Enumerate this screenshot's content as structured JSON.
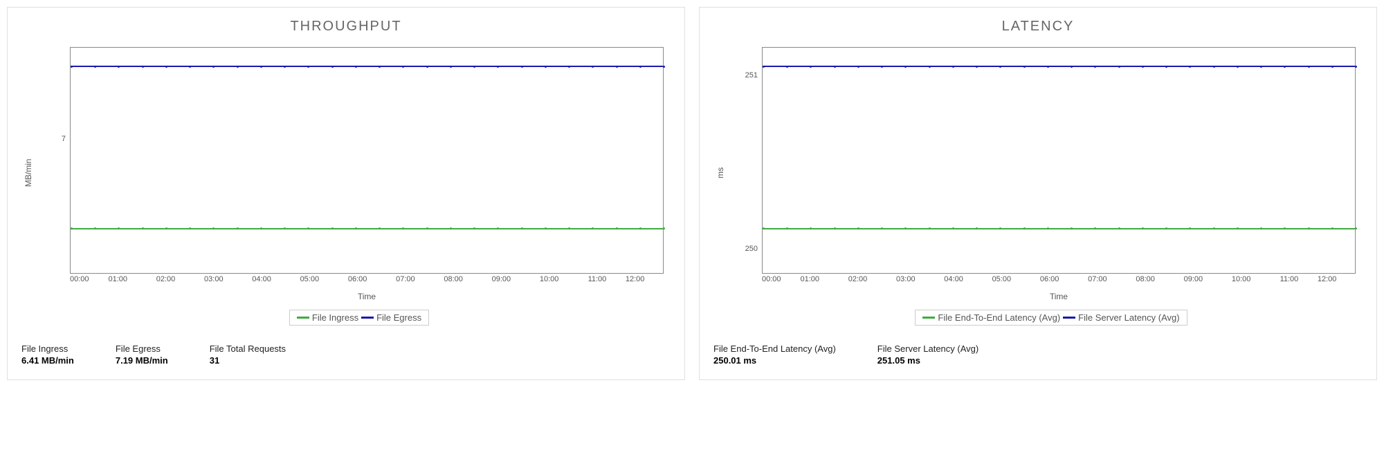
{
  "panels": {
    "throughput": {
      "title": "THROUGHPUT",
      "ylabel": "MB/min",
      "xlabel": "Time",
      "legend": {
        "a": "File Ingress",
        "b": "File Egress"
      },
      "ytick": "7",
      "stats": [
        {
          "label": "File Ingress",
          "value": "6.41 MB/min"
        },
        {
          "label": "File Egress",
          "value": "7.19 MB/min"
        },
        {
          "label": "File Total Requests",
          "value": "31"
        }
      ]
    },
    "latency": {
      "title": "LATENCY",
      "ylabel": "ms",
      "xlabel": "Time",
      "legend": {
        "a": "File End-To-End Latency (Avg)",
        "b": "File Server Latency (Avg)"
      },
      "yticks": {
        "top": "251",
        "bottom": "250"
      },
      "stats": [
        {
          "label": "File End-To-End Latency (Avg)",
          "value": "250.01 ms"
        },
        {
          "label": "File Server Latency (Avg)",
          "value": "251.05 ms"
        }
      ]
    }
  },
  "x_categories": [
    "00:00",
    "01:00",
    "02:00",
    "03:00",
    "04:00",
    "05:00",
    "06:00",
    "07:00",
    "08:00",
    "09:00",
    "10:00",
    "11:00",
    "12:00"
  ],
  "colors": {
    "green": "#3fab3f",
    "blue": "#1a1aaa"
  },
  "chart_data": [
    {
      "type": "line",
      "title": "THROUGHPUT",
      "xlabel": "Time",
      "ylabel": "MB/min",
      "x": [
        "00:00",
        "01:00",
        "02:00",
        "03:00",
        "04:00",
        "05:00",
        "06:00",
        "07:00",
        "08:00",
        "09:00",
        "10:00",
        "11:00",
        "12:00"
      ],
      "series": [
        {
          "name": "File Ingress",
          "color": "#3fab3f",
          "values": [
            6.41,
            6.41,
            6.41,
            6.41,
            6.41,
            6.41,
            6.41,
            6.41,
            6.41,
            6.41,
            6.41,
            6.41,
            6.41
          ]
        },
        {
          "name": "File Egress",
          "color": "#1a1aaa",
          "values": [
            7.19,
            7.19,
            7.19,
            7.19,
            7.19,
            7.19,
            7.19,
            7.19,
            7.19,
            7.19,
            7.19,
            7.19,
            7.19
          ]
        }
      ],
      "ylim": [
        6.3,
        7.3
      ]
    },
    {
      "type": "line",
      "title": "LATENCY",
      "xlabel": "Time",
      "ylabel": "ms",
      "x": [
        "00:00",
        "01:00",
        "02:00",
        "03:00",
        "04:00",
        "05:00",
        "06:00",
        "07:00",
        "08:00",
        "09:00",
        "10:00",
        "11:00",
        "12:00"
      ],
      "series": [
        {
          "name": "File End-To-End Latency (Avg)",
          "color": "#3fab3f",
          "values": [
            250.01,
            250.01,
            250.01,
            250.01,
            250.01,
            250.01,
            250.01,
            250.01,
            250.01,
            250.01,
            250.01,
            250.01,
            250.01
          ]
        },
        {
          "name": "File Server Latency (Avg)",
          "color": "#1a1aaa",
          "values": [
            251.05,
            251.05,
            251.05,
            251.05,
            251.05,
            251.05,
            251.05,
            251.05,
            251.05,
            251.05,
            251.05,
            251.05,
            251.05
          ]
        }
      ],
      "ylim": [
        249.9,
        251.2
      ]
    }
  ]
}
